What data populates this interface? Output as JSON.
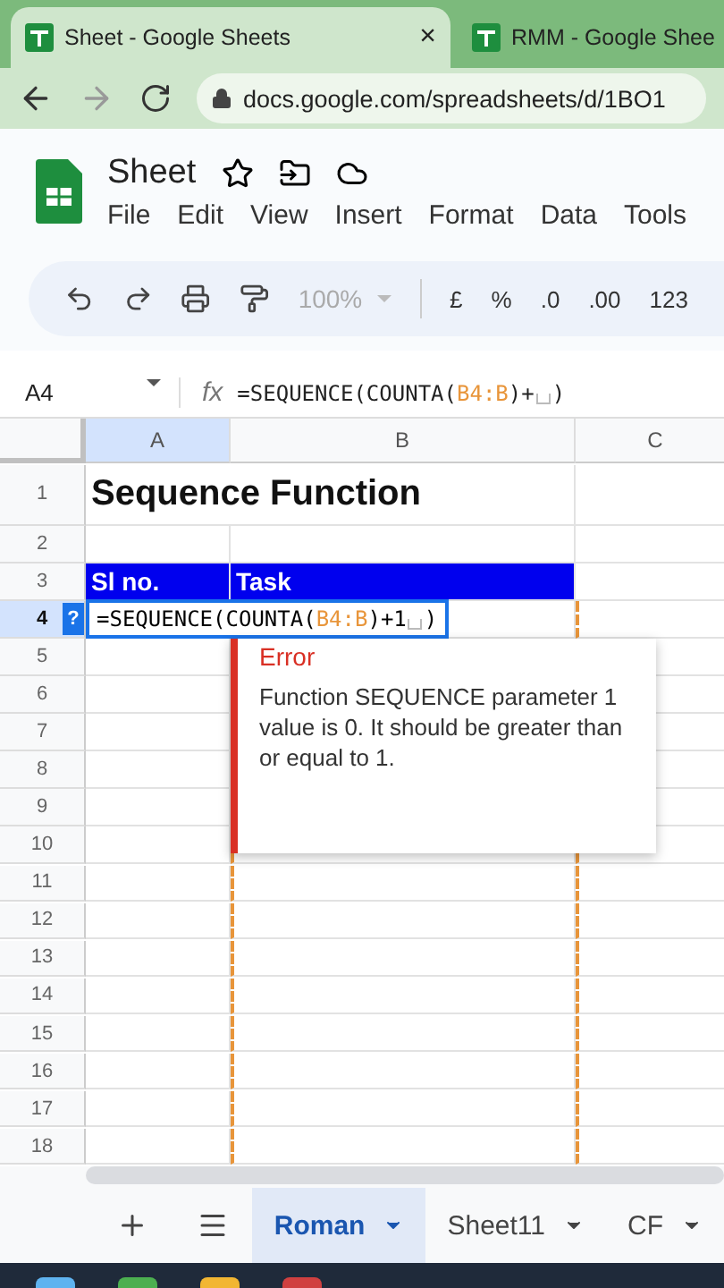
{
  "browser_tabs": [
    {
      "title": "Sheet - Google Sheets",
      "selected": true,
      "close": "×"
    },
    {
      "title": "RMM - Google Shee",
      "selected": false
    }
  ],
  "address": "docs.google.com/spreadsheets/d/1BO1",
  "doc_title": "Sheet",
  "menu": [
    "File",
    "Edit",
    "View",
    "Insert",
    "Format",
    "Data",
    "Tools"
  ],
  "toolbar": {
    "zoom": "100%",
    "formats": [
      "£",
      "%",
      ".0",
      ".00",
      "123"
    ]
  },
  "name_box": "A4",
  "fx": "fx",
  "formula_parts": [
    {
      "kind": "text",
      "text": "=SEQUENCE(COUNTA("
    },
    {
      "kind": "range",
      "text": "B4:B"
    },
    {
      "kind": "text",
      "text": ")+"
    },
    {
      "kind": "slot"
    },
    {
      "kind": "text",
      "text": ")"
    }
  ],
  "columns": [
    {
      "label": "A",
      "selected": true
    },
    {
      "label": "B",
      "selected": false
    },
    {
      "label": "C",
      "selected": false
    }
  ],
  "rows": [
    {
      "number": "1",
      "selected": false,
      "cells": [
        "Sequence Function"
      ],
      "kind": "title"
    },
    {
      "number": "2",
      "selected": false,
      "cells": [],
      "kind": "plain"
    },
    {
      "number": "3",
      "selected": false,
      "cells": [
        "Sl no.",
        "Task"
      ],
      "kind": "header"
    },
    {
      "number": "4",
      "selected": true,
      "cells": [],
      "kind": "plain"
    },
    {
      "number": "5",
      "selected": false,
      "cells": [],
      "kind": "plain"
    },
    {
      "number": "6",
      "selected": false,
      "cells": [],
      "kind": "plain"
    },
    {
      "number": "7",
      "selected": false,
      "cells": [],
      "kind": "plain"
    },
    {
      "number": "8",
      "selected": false,
      "cells": [],
      "kind": "plain"
    },
    {
      "number": "9",
      "selected": false,
      "cells": [],
      "kind": "plain"
    },
    {
      "number": "10",
      "selected": false,
      "cells": [],
      "kind": "plain"
    },
    {
      "number": "11",
      "selected": false,
      "cells": [],
      "kind": "plain"
    },
    {
      "number": "12",
      "selected": false,
      "cells": [],
      "kind": "plain"
    },
    {
      "number": "13",
      "selected": false,
      "cells": [],
      "kind": "plain"
    },
    {
      "number": "14",
      "selected": false,
      "cells": [],
      "kind": "plain"
    },
    {
      "number": "15",
      "selected": false,
      "cells": [],
      "kind": "plain"
    },
    {
      "number": "16",
      "selected": false,
      "cells": [],
      "kind": "plain"
    },
    {
      "number": "17",
      "selected": false,
      "cells": [],
      "kind": "plain"
    },
    {
      "number": "18",
      "selected": false,
      "cells": [],
      "kind": "plain"
    }
  ],
  "editor": {
    "help": "?",
    "parts": [
      {
        "kind": "text",
        "text": "=SEQUENCE(COUNTA("
      },
      {
        "kind": "range",
        "text": "B4:B"
      },
      {
        "kind": "text",
        "text": ")+1"
      },
      {
        "kind": "slot"
      },
      {
        "kind": "text",
        "text": ")"
      }
    ]
  },
  "error": {
    "title": "Error",
    "message": "Function SEQUENCE parameter 1 value is 0. It should be greater than or equal to 1."
  },
  "sheet_tabs": [
    {
      "label": "Roman",
      "selected": true
    },
    {
      "label": "Sheet11",
      "selected": false
    },
    {
      "label": "CF",
      "selected": false
    }
  ]
}
